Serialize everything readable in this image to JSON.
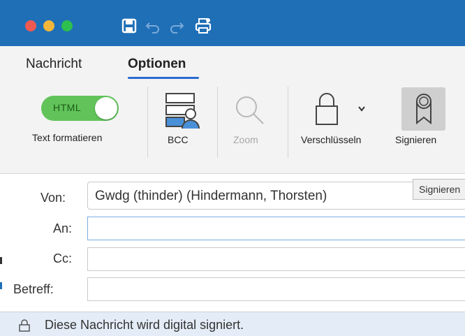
{
  "colors": {
    "titlebar": "#1f6fb7",
    "accent": "#2a6bd1",
    "toggle_on": "#61c35a",
    "statusbar": "#e4edf7"
  },
  "titlebar": {
    "icons": [
      "save-icon",
      "undo-icon",
      "redo-icon",
      "print-icon"
    ]
  },
  "tabs": [
    {
      "label": "Nachricht",
      "active": false
    },
    {
      "label": "Optionen",
      "active": true
    }
  ],
  "ribbon": {
    "format_toggle": {
      "label": "HTML",
      "state": "on"
    },
    "format_caption": "Text formatieren",
    "bcc_label": "BCC",
    "zoom_label": "Zoom",
    "encrypt_label": "Verschlüsseln",
    "sign_label": "Signieren"
  },
  "form": {
    "from_label": "Von:",
    "from_value": "Gwdg (thinder) (Hindermann, Thorsten)",
    "to_label": "An:",
    "to_value": "",
    "cc_label": "Cc:",
    "cc_value": "",
    "subject_label": "Betreff:",
    "subject_value": ""
  },
  "tooltip": "Signieren",
  "status": {
    "text": "Diese Nachricht wird digital signiert.",
    "icon": "lock-icon"
  }
}
